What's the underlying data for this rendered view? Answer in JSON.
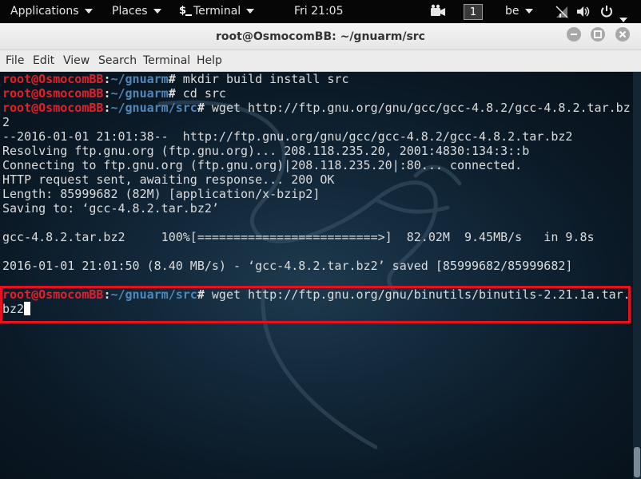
{
  "topbar": {
    "applications": "Applications",
    "places": "Places",
    "terminal_app": "Terminal",
    "clock": "Fri 21:05",
    "workspace": "1",
    "keyboard_layout": "be"
  },
  "window": {
    "title": "root@OsmocomBB: ~/gnuarm/src"
  },
  "menu": [
    "File",
    "Edit",
    "View",
    "Search",
    "Terminal",
    "Help"
  ],
  "terminal": {
    "lines": [
      {
        "user": "root@OsmocomBB",
        "sep": ":",
        "path": "~/gnuarm",
        "sym": "# ",
        "cmd": "mkdir build install src"
      },
      {
        "user": "root@OsmocomBB",
        "sep": ":",
        "path": "~/gnuarm",
        "sym": "# ",
        "cmd": "cd src"
      },
      {
        "user": "root@OsmocomBB",
        "sep": ":",
        "path": "~/gnuarm/src",
        "sym": "# ",
        "cmd": "wget http://ftp.gnu.org/gnu/gcc/gcc-4.8.2/gcc-4.8.2.tar.bz"
      },
      {
        "text": "2"
      },
      {
        "text": "--2016-01-01 21:01:38--  http://ftp.gnu.org/gnu/gcc/gcc-4.8.2/gcc-4.8.2.tar.bz2"
      },
      {
        "text": "Resolving ftp.gnu.org (ftp.gnu.org)... 208.118.235.20, 2001:4830:134:3::b"
      },
      {
        "text": "Connecting to ftp.gnu.org (ftp.gnu.org)|208.118.235.20|:80... connected."
      },
      {
        "text": "HTTP request sent, awaiting response... 200 OK"
      },
      {
        "text": "Length: 85999682 (82M) [application/x-bzip2]"
      },
      {
        "text": "Saving to: ‘gcc-4.8.2.tar.bz2’"
      },
      {
        "text": ""
      },
      {
        "text": "gcc-4.8.2.tar.bz2     100%[=========================>]  82.02M  9.45MB/s   in 9.8s"
      },
      {
        "text": ""
      },
      {
        "text": "2016-01-01 21:01:50 (8.40 MB/s) - ‘gcc-4.8.2.tar.bz2’ saved [85999682/85999682]"
      },
      {
        "text": ""
      },
      {
        "user": "root@OsmocomBB",
        "sep": ":",
        "path": "~/gnuarm/src",
        "sym": "# ",
        "cmd": "wget http://ftp.gnu.org/gnu/binutils/binutils-2.21.1a.tar."
      },
      {
        "text": "bz2",
        "cursor": true
      }
    ]
  },
  "colors": {
    "prompt_user": "#e0202a",
    "prompt_path": "#4f88b8",
    "highlight_box": "#e8101e"
  },
  "icons": [
    "chevron-down-icon",
    "terminal-app-icon",
    "video-camera-icon",
    "network-icon",
    "volume-icon",
    "power-icon",
    "minimize-icon",
    "maximize-icon",
    "close-icon",
    "kali-dragon-watermark"
  ]
}
